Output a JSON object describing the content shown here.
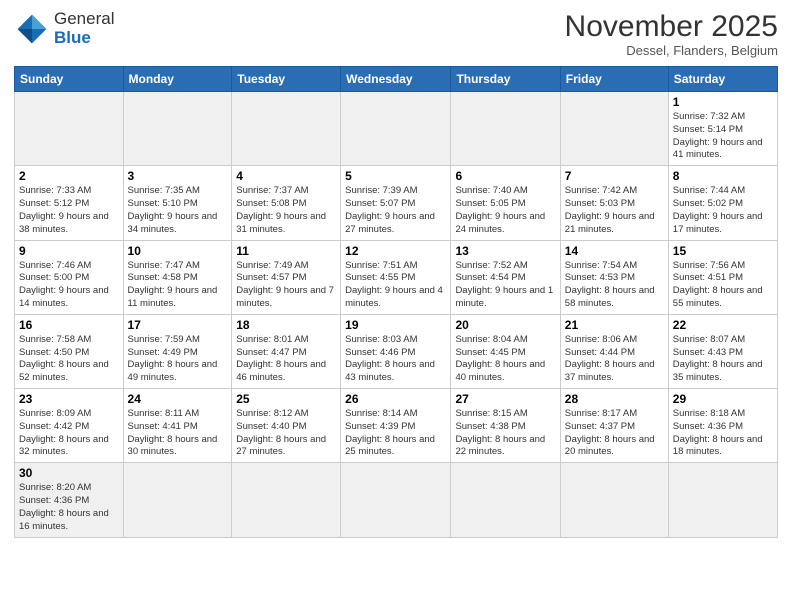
{
  "header": {
    "logo_text_general": "General",
    "logo_text_blue": "Blue",
    "month_title": "November 2025",
    "subtitle": "Dessel, Flanders, Belgium"
  },
  "weekdays": [
    "Sunday",
    "Monday",
    "Tuesday",
    "Wednesday",
    "Thursday",
    "Friday",
    "Saturday"
  ],
  "weeks": [
    [
      {
        "day": "",
        "info": ""
      },
      {
        "day": "",
        "info": ""
      },
      {
        "day": "",
        "info": ""
      },
      {
        "day": "",
        "info": ""
      },
      {
        "day": "",
        "info": ""
      },
      {
        "day": "",
        "info": ""
      },
      {
        "day": "1",
        "info": "Sunrise: 7:32 AM\nSunset: 5:14 PM\nDaylight: 9 hours and 41 minutes."
      }
    ],
    [
      {
        "day": "2",
        "info": "Sunrise: 7:33 AM\nSunset: 5:12 PM\nDaylight: 9 hours and 38 minutes."
      },
      {
        "day": "3",
        "info": "Sunrise: 7:35 AM\nSunset: 5:10 PM\nDaylight: 9 hours and 34 minutes."
      },
      {
        "day": "4",
        "info": "Sunrise: 7:37 AM\nSunset: 5:08 PM\nDaylight: 9 hours and 31 minutes."
      },
      {
        "day": "5",
        "info": "Sunrise: 7:39 AM\nSunset: 5:07 PM\nDaylight: 9 hours and 27 minutes."
      },
      {
        "day": "6",
        "info": "Sunrise: 7:40 AM\nSunset: 5:05 PM\nDaylight: 9 hours and 24 minutes."
      },
      {
        "day": "7",
        "info": "Sunrise: 7:42 AM\nSunset: 5:03 PM\nDaylight: 9 hours and 21 minutes."
      },
      {
        "day": "8",
        "info": "Sunrise: 7:44 AM\nSunset: 5:02 PM\nDaylight: 9 hours and 17 minutes."
      }
    ],
    [
      {
        "day": "9",
        "info": "Sunrise: 7:46 AM\nSunset: 5:00 PM\nDaylight: 9 hours and 14 minutes."
      },
      {
        "day": "10",
        "info": "Sunrise: 7:47 AM\nSunset: 4:58 PM\nDaylight: 9 hours and 11 minutes."
      },
      {
        "day": "11",
        "info": "Sunrise: 7:49 AM\nSunset: 4:57 PM\nDaylight: 9 hours and 7 minutes."
      },
      {
        "day": "12",
        "info": "Sunrise: 7:51 AM\nSunset: 4:55 PM\nDaylight: 9 hours and 4 minutes."
      },
      {
        "day": "13",
        "info": "Sunrise: 7:52 AM\nSunset: 4:54 PM\nDaylight: 9 hours and 1 minute."
      },
      {
        "day": "14",
        "info": "Sunrise: 7:54 AM\nSunset: 4:53 PM\nDaylight: 8 hours and 58 minutes."
      },
      {
        "day": "15",
        "info": "Sunrise: 7:56 AM\nSunset: 4:51 PM\nDaylight: 8 hours and 55 minutes."
      }
    ],
    [
      {
        "day": "16",
        "info": "Sunrise: 7:58 AM\nSunset: 4:50 PM\nDaylight: 8 hours and 52 minutes."
      },
      {
        "day": "17",
        "info": "Sunrise: 7:59 AM\nSunset: 4:49 PM\nDaylight: 8 hours and 49 minutes."
      },
      {
        "day": "18",
        "info": "Sunrise: 8:01 AM\nSunset: 4:47 PM\nDaylight: 8 hours and 46 minutes."
      },
      {
        "day": "19",
        "info": "Sunrise: 8:03 AM\nSunset: 4:46 PM\nDaylight: 8 hours and 43 minutes."
      },
      {
        "day": "20",
        "info": "Sunrise: 8:04 AM\nSunset: 4:45 PM\nDaylight: 8 hours and 40 minutes."
      },
      {
        "day": "21",
        "info": "Sunrise: 8:06 AM\nSunset: 4:44 PM\nDaylight: 8 hours and 37 minutes."
      },
      {
        "day": "22",
        "info": "Sunrise: 8:07 AM\nSunset: 4:43 PM\nDaylight: 8 hours and 35 minutes."
      }
    ],
    [
      {
        "day": "23",
        "info": "Sunrise: 8:09 AM\nSunset: 4:42 PM\nDaylight: 8 hours and 32 minutes."
      },
      {
        "day": "24",
        "info": "Sunrise: 8:11 AM\nSunset: 4:41 PM\nDaylight: 8 hours and 30 minutes."
      },
      {
        "day": "25",
        "info": "Sunrise: 8:12 AM\nSunset: 4:40 PM\nDaylight: 8 hours and 27 minutes."
      },
      {
        "day": "26",
        "info": "Sunrise: 8:14 AM\nSunset: 4:39 PM\nDaylight: 8 hours and 25 minutes."
      },
      {
        "day": "27",
        "info": "Sunrise: 8:15 AM\nSunset: 4:38 PM\nDaylight: 8 hours and 22 minutes."
      },
      {
        "day": "28",
        "info": "Sunrise: 8:17 AM\nSunset: 4:37 PM\nDaylight: 8 hours and 20 minutes."
      },
      {
        "day": "29",
        "info": "Sunrise: 8:18 AM\nSunset: 4:36 PM\nDaylight: 8 hours and 18 minutes."
      }
    ],
    [
      {
        "day": "30",
        "info": "Sunrise: 8:20 AM\nSunset: 4:36 PM\nDaylight: 8 hours and 16 minutes."
      },
      {
        "day": "",
        "info": ""
      },
      {
        "day": "",
        "info": ""
      },
      {
        "day": "",
        "info": ""
      },
      {
        "day": "",
        "info": ""
      },
      {
        "day": "",
        "info": ""
      },
      {
        "day": "",
        "info": ""
      }
    ]
  ]
}
